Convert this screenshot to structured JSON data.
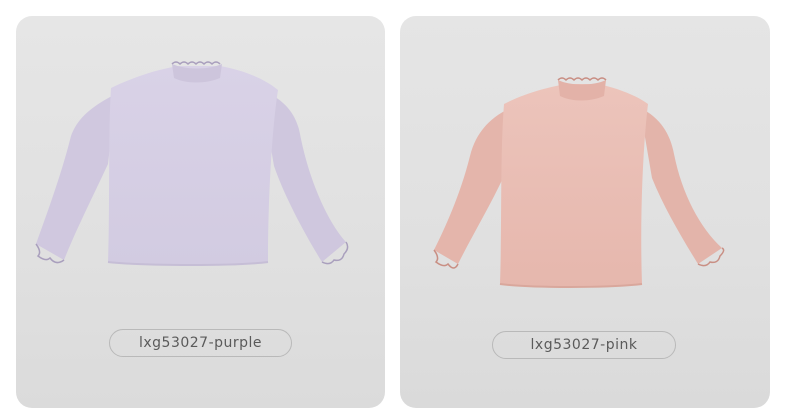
{
  "products": [
    {
      "label": "lxg53027-purple",
      "color": "#d6cfe5"
    },
    {
      "label": "lxg53027-pink",
      "color": "#e9bcb3"
    }
  ]
}
